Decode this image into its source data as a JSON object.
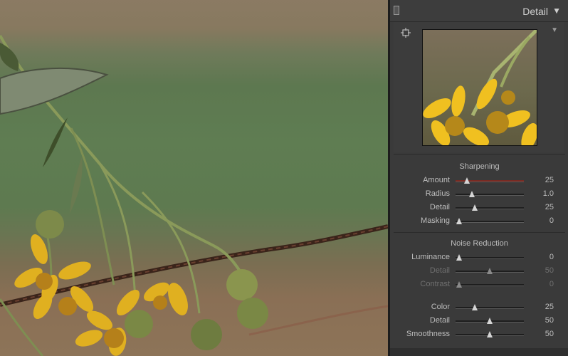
{
  "panel": {
    "title": "Detail",
    "collapse_icon": "triangle-down-icon",
    "toggle_icon": "panel-switch-icon"
  },
  "preview": {
    "target_icon": "crosshair-target-icon",
    "menu_icon": "triangle-down-icon"
  },
  "sharpening": {
    "title": "Sharpening",
    "sliders": [
      {
        "label": "Amount",
        "value": "25",
        "fraction": 0.17
      },
      {
        "label": "Radius",
        "value": "1.0",
        "fraction": 0.24
      },
      {
        "label": "Detail",
        "value": "25",
        "fraction": 0.28
      },
      {
        "label": "Masking",
        "value": "0",
        "fraction": 0.05
      }
    ]
  },
  "noise_reduction": {
    "title": "Noise Reduction",
    "sliders": [
      {
        "label": "Luminance",
        "value": "0",
        "fraction": 0.05,
        "dim": false
      },
      {
        "label": "Detail",
        "value": "50",
        "fraction": 0.5,
        "dim": true
      },
      {
        "label": "Contrast",
        "value": "0",
        "fraction": 0.05,
        "dim": true
      },
      {
        "label": "Color",
        "value": "25",
        "fraction": 0.28,
        "dim": false
      },
      {
        "label": "Detail",
        "value": "50",
        "fraction": 0.5,
        "dim": false
      },
      {
        "label": "Smoothness",
        "value": "50",
        "fraction": 0.5,
        "dim": false
      }
    ]
  },
  "colors": {
    "panel_bg": "#3a3a3a",
    "text": "#bdbdbd",
    "dim_text": "#6f6f6f",
    "amount_track": "#7a2a22"
  }
}
